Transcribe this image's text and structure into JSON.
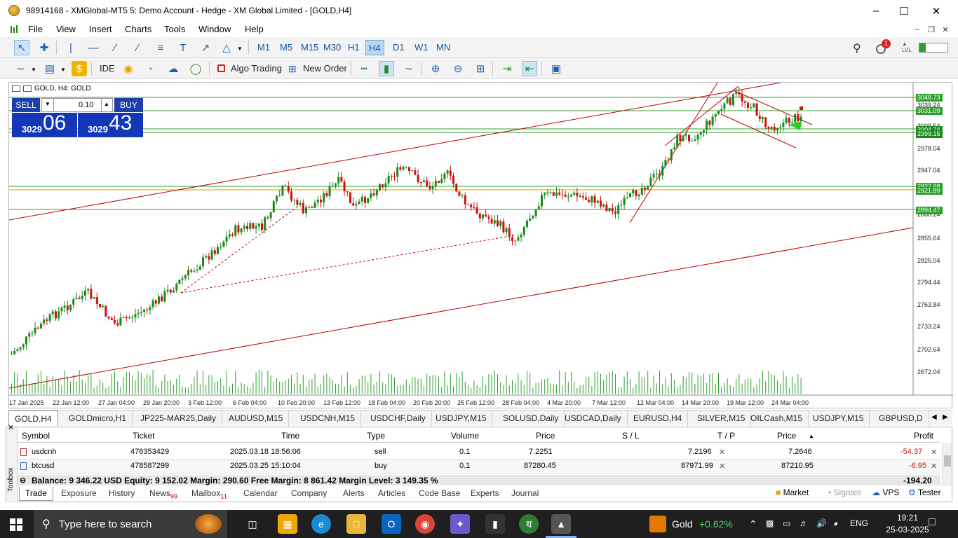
{
  "window": {
    "title": "98914168 - XMGlobal-MT5 5: Demo Account - Hedge - XM Global Limited - [GOLD,H4]"
  },
  "menu": [
    "File",
    "View",
    "Insert",
    "Charts",
    "Tools",
    "Window",
    "Help"
  ],
  "timeframes": [
    "M1",
    "M5",
    "M15",
    "M30",
    "H1",
    "H4",
    "D1",
    "W1",
    "MN"
  ],
  "active_timeframe": "H4",
  "notifications_count": "1",
  "toolbar2": {
    "ide": "IDE",
    "algo_trading": "Algo Trading",
    "new_order": "New Order"
  },
  "chart": {
    "header": "GOLD, H4:  GOLD",
    "sell_label": "SELL",
    "buy_label": "BUY",
    "lot": "0.10",
    "bid_small": "3029",
    "bid_big": "06",
    "ask_small": "3029",
    "ask_big": "43",
    "price_axis": [
      "3039.24",
      "3009.54",
      "2978.04",
      "2947.04",
      "2916.04",
      "2886.24",
      "2855.64",
      "2825.04",
      "2794.44",
      "2763.84",
      "2733.24",
      "2702.64",
      "2672.04"
    ],
    "price_tags": [
      "3048.73",
      "3031.09",
      "3004.74",
      "2999.15",
      "2927.68",
      "2921.89",
      "2894.47"
    ],
    "time_axis": [
      "17 Jan 2025",
      "22 Jan 12:00",
      "27 Jan 04:00",
      "29 Jan 20:00",
      "3 Feb 12:00",
      "6 Feb 04:00",
      "10 Feb 20:00",
      "13 Feb 12:00",
      "18 Feb 04:00",
      "20 Feb 20:00",
      "25 Feb 12:00",
      "28 Feb 04:00",
      "4 Mar 20:00",
      "7 Mar 12:00",
      "12 Mar 04:00",
      "14 Mar 20:00",
      "19 Mar 12:00",
      "24 Mar 04:00"
    ]
  },
  "chart_tabs": [
    "GOLD,H4",
    "GOLDmicro,H1",
    "JP225-MAR25,Daily",
    "AUDUSD,M15",
    "USDCNH,M15",
    "USDCHF,Daily",
    "USDJPY,M15",
    "SOLUSD,Daily",
    "USDCAD,Daily",
    "EURUSD,H4",
    "SILVER,M15",
    "OILCash,M15",
    "USDJPY,M15",
    "GBPUSD,D"
  ],
  "terminal": {
    "toolbox_label": "Toolbox",
    "columns": [
      "Symbol",
      "Ticket",
      "Time",
      "Type",
      "Volume",
      "Price",
      "S / L",
      "T / P",
      "Price",
      "Profit"
    ],
    "rows": [
      {
        "symbol": "usdcnh",
        "ticket": "476353429",
        "time": "2025.03.18 18:56:06",
        "type": "sell",
        "volume": "0.1",
        "price": "7.2251",
        "sl": "",
        "tp": "7.2196",
        "current": "7.2646",
        "profit": "-54.37"
      },
      {
        "symbol": "btcusd",
        "ticket": "478587299",
        "time": "2025.03.25 15:10:04",
        "type": "buy",
        "volume": "0.1",
        "price": "87280.45",
        "sl": "",
        "tp": "87971.99",
        "current": "87210.95",
        "profit": "-6.95"
      }
    ],
    "balance_line": "Balance: 9 346.22 USD  Equity: 9 152.02  Margin: 290.60  Free Margin: 8 861.42  Margin Level: 3 149.35 %",
    "total_profit": "-194.20",
    "tabs": [
      "Trade",
      "Exposure",
      "History",
      "News",
      "Mailbox",
      "Calendar",
      "Company",
      "Alerts",
      "Articles",
      "Code Base",
      "Experts",
      "Journal"
    ],
    "news_badge": "99",
    "mailbox_badge": "11",
    "right_links": [
      "Market",
      "Signals",
      "VPS",
      "Tester"
    ]
  },
  "taskbar": {
    "search_placeholder": "Type here to search",
    "ticker_name": "Gold",
    "ticker_change": "+0.62%",
    "language": "ENG",
    "time": "19:21",
    "date": "25-03-2025"
  },
  "colors": {
    "bull_candle": "#1a8a1a",
    "bear_candle": "#d01010",
    "trend_line": "#c00000",
    "level_line": "#2ca02c",
    "accent": "#1e3fa8"
  }
}
